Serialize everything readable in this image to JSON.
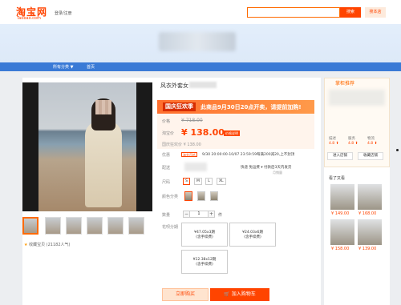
{
  "header": {
    "logo_text": "淘宝网",
    "logo_sub": "Taobao.com",
    "login_link": "登录/注册",
    "search_button": "搜索",
    "store_button": "搜本店"
  },
  "nav": {
    "items": [
      "所有分类 ▼",
      "首页"
    ]
  },
  "product": {
    "title": "风衣外套女",
    "promo_tag": "国庆狂欢季",
    "promo_text": "此商品9月30日20点开卖，请提前加购!",
    "price_label": "价格",
    "original_price": "¥ 718.00",
    "taobao_price_label": "淘宝价",
    "price": "¥ 138.00",
    "price_badge": "价格说明",
    "phone_price": "国庆狂欢价 ¥ 138.00",
    "coupon_label": "优惠",
    "coupon_tag": "淘金币抵",
    "coupon_text": "9/30 20:00:00-10/07 23:59:59每满200减20,上不封顶",
    "ship_label": "配送",
    "ship_text": "快递 免运费  ▾  付款后3天内发货",
    "ship_sub": "月销量",
    "size_label": "尺码",
    "sizes": [
      "S",
      "M",
      "L",
      "XL"
    ],
    "color_label": "颜色分类",
    "qty_label": "数量",
    "qty_value": "1",
    "qty_unit": "件",
    "installment_label": "花呗分期",
    "installments": [
      {
        "amount": "¥47.05x3期",
        "note": "(含手续费)"
      },
      {
        "amount": "¥24.03x6期",
        "note": "(含手续费)"
      },
      {
        "amount": "¥12.38x12期",
        "note": "(含手续费)"
      }
    ],
    "buy_now": "立即购买",
    "add_cart": "加入购物车",
    "favorite": "收藏宝贝 (21182人气)"
  },
  "shop": {
    "head": "掌柜推荐",
    "ratings": [
      {
        "label": "描述",
        "value": "4.8 ⬆"
      },
      {
        "label": "服务",
        "value": "4.8 ⬆"
      },
      {
        "label": "物流",
        "value": "4.8 ⬆"
      }
    ],
    "enter_shop": "进入店铺",
    "follow_shop": "收藏店铺",
    "rec_head": "看了又看",
    "rec_prices": [
      "¥ 149.00",
      "¥ 168.00",
      "¥ 158.00",
      "¥ 139.00"
    ]
  }
}
